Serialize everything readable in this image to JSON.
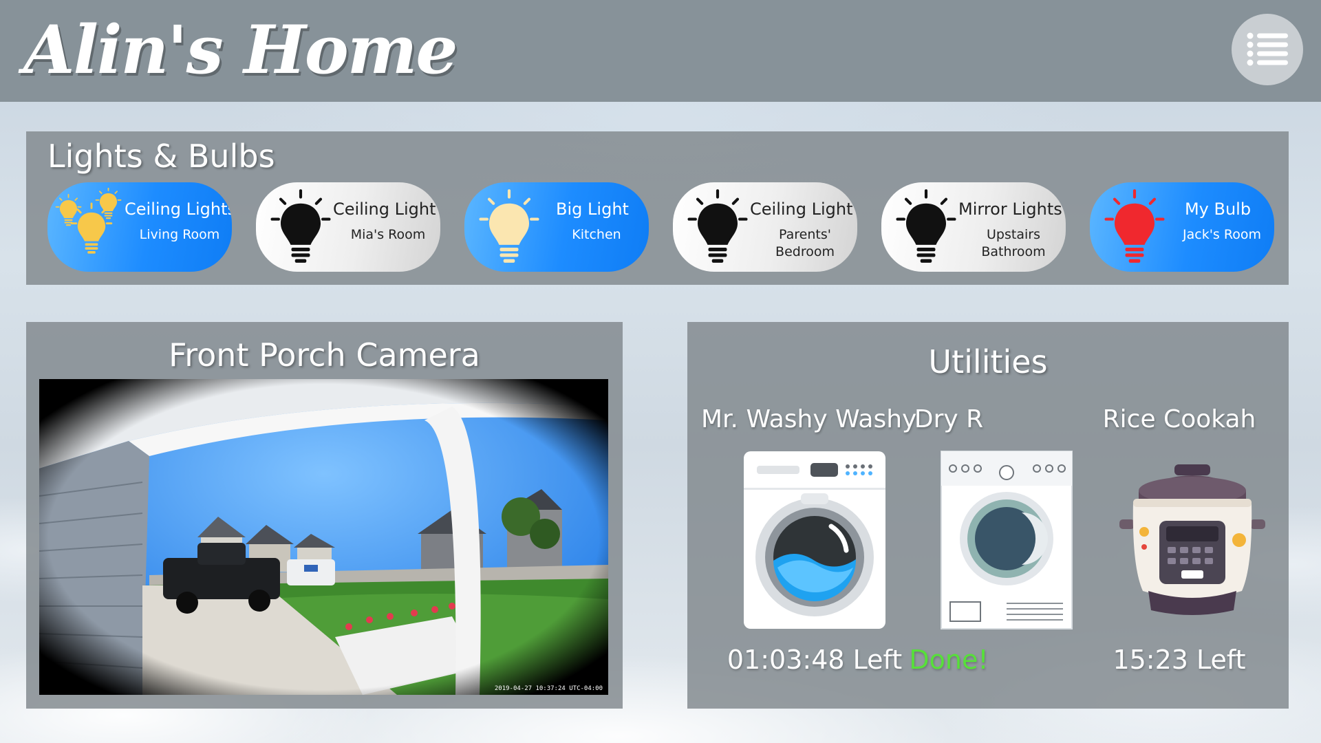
{
  "header": {
    "title": "Alin's Home",
    "menu_icon": "menu-list-icon"
  },
  "lights": {
    "title": "Lights & Bulbs",
    "items": [
      {
        "name": "Ceiling Lights",
        "location": "Living Room",
        "state": "on",
        "bulb_color": "#f7c84a",
        "icon": "multi-bulb-icon"
      },
      {
        "name": "Ceiling Light",
        "location": "Mia's Room",
        "state": "off",
        "bulb_color": "#111111",
        "icon": "lightbulb-icon"
      },
      {
        "name": "Big Light",
        "location": "Kitchen",
        "state": "on",
        "bulb_color": "#fbe6b0",
        "icon": "lightbulb-icon"
      },
      {
        "name": "Ceiling Light",
        "location": "Parents' Bedroom",
        "state": "off",
        "bulb_color": "#111111",
        "icon": "lightbulb-icon"
      },
      {
        "name": "Mirror Lights",
        "location": "Upstairs Bathroom",
        "state": "off",
        "bulb_color": "#111111",
        "icon": "lightbulb-icon"
      },
      {
        "name": "My Bulb",
        "location": "Jack's Room",
        "state": "on",
        "bulb_color": "#f0282e",
        "icon": "lightbulb-icon"
      }
    ]
  },
  "camera": {
    "title": "Front Porch Camera",
    "timestamp": "2019-04-27 10:37:24 UTC-04:00"
  },
  "utilities": {
    "title": "Utilities",
    "items": [
      {
        "name": "Mr. Washy Washy",
        "status": "01:03:48 Left",
        "status_color": "#ffffff",
        "icon": "washing-machine-icon"
      },
      {
        "name": "Dry R",
        "status": "Done!",
        "status_color": "#57e03a",
        "icon": "dryer-icon"
      },
      {
        "name": "Rice Cookah",
        "status": "15:23 Left",
        "status_color": "#ffffff",
        "icon": "rice-cooker-icon"
      }
    ]
  }
}
